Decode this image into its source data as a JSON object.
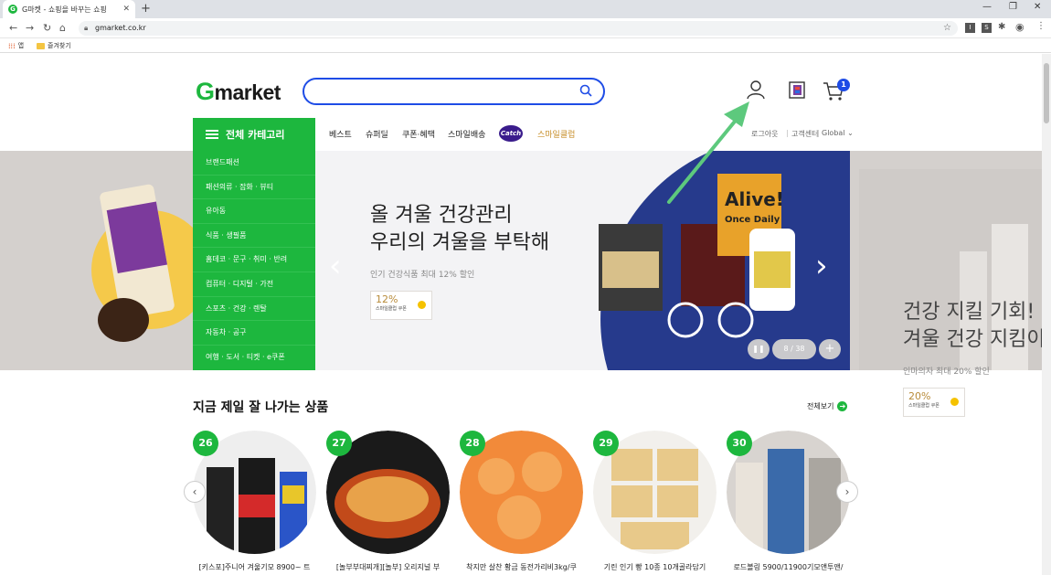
{
  "browser": {
    "tab_title": "G마켓 - 쇼핑을 바꾸는 쇼핑",
    "tab_favicon_letter": "G",
    "url": "gmarket.co.kr",
    "bookmarks": [
      {
        "label": "앱"
      },
      {
        "label": "즐겨찾기"
      }
    ],
    "extensions": [
      "I",
      "S"
    ]
  },
  "header": {
    "logo_g": "G",
    "logo_rest": "market",
    "search_placeholder": "",
    "cart_count": "1"
  },
  "category": {
    "button_label": "전체 카테고리",
    "items": [
      "브랜드패션",
      "패션의류 · 잡화 · 뷰티",
      "유아동",
      "식품 · 생필품",
      "홈데코 · 문구 · 취미 · 반려",
      "컴퓨터 · 디지털 · 가전",
      "스포츠 · 건강 · 렌탈",
      "자동차 · 공구",
      "여행 · 도서 · 티켓 · e쿠폰"
    ]
  },
  "gnb": {
    "items": [
      "베스트",
      "슈퍼딜",
      "쿠폰·혜택",
      "스마일배송"
    ],
    "catch_label": "Catch",
    "smile_club": "스마일클럽",
    "logout": "로그아웃",
    "customer_center": "고객센터",
    "global": "Global"
  },
  "hero": {
    "title_line1": "올 겨울 건강관리",
    "title_line2": "우리의 겨울을 부탁해",
    "subtitle": "인기 건강식품 최대 12% 할인",
    "coupon_value": "12%",
    "coupon_label": "스마일클럽 쿠폰",
    "product_brand": "Alive!",
    "product_line": "Once Daily",
    "pager_text": "8 / 38",
    "next_title_line1": "건강 지킬 기회!",
    "next_title_line2": "겨울 건강 지킴이",
    "next_subtitle": "인마의자 최대 20% 할인",
    "next_coupon_value": "20%",
    "next_coupon_label": "스마일클럽 쿠폰"
  },
  "bestsellers": {
    "title": "지금 제일 잘 나가는 상품",
    "view_all": "전체보기",
    "products": [
      {
        "rank": "26",
        "name": "[키스포]주니어 겨울기모 8900~ 트"
      },
      {
        "rank": "27",
        "name": "[놀부부대찌개][놀부] 오리지널 부"
      },
      {
        "rank": "28",
        "name": "착지만 살찬 황금 동전가리비3kg/쿠"
      },
      {
        "rank": "29",
        "name": "기린 인기 빵 10종 10개골라담기"
      },
      {
        "rank": "30",
        "name": "로드볼링 5900/11900기모앤투앤/"
      }
    ]
  },
  "colors": {
    "brand_green": "#1db73e",
    "search_blue": "#1e4ce6",
    "annotation_arrow": "#5dc97d"
  }
}
